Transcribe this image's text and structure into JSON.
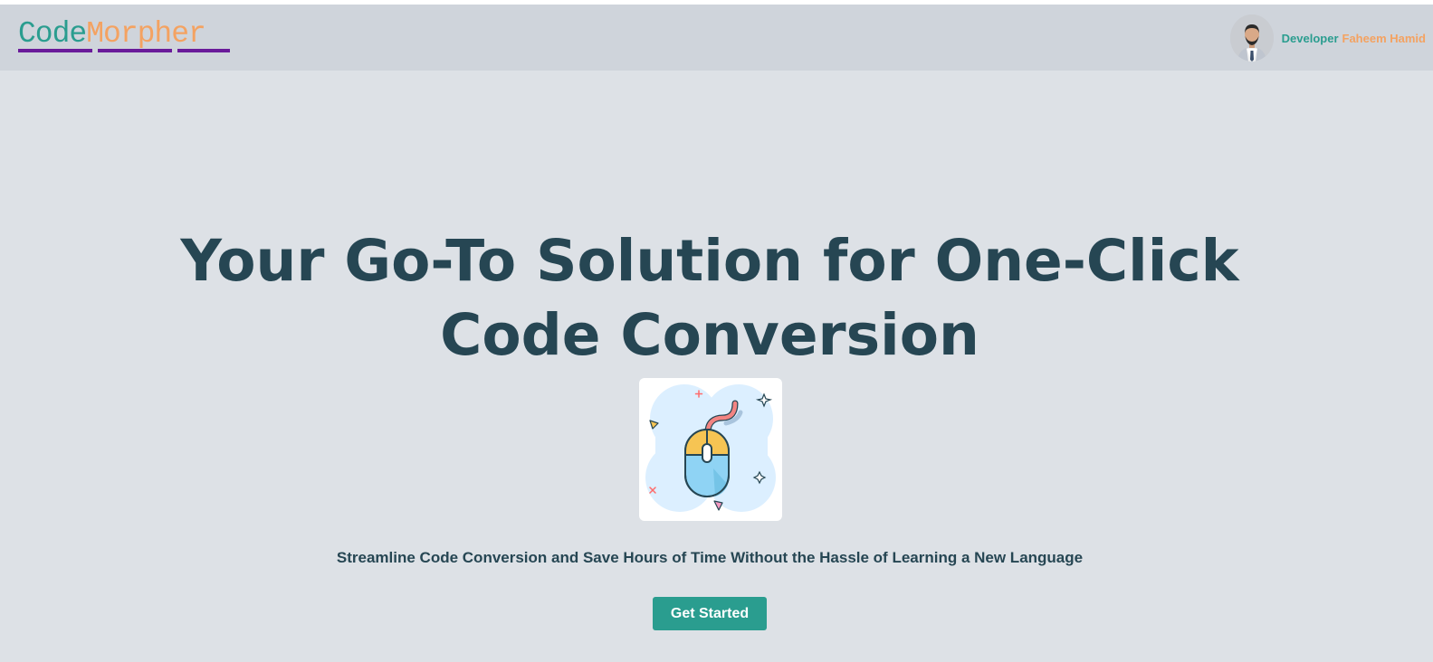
{
  "header": {
    "logo": {
      "part1": "Code",
      "part2": "Morpher"
    },
    "developer": {
      "label": "Developer",
      "name": "Faheem Hamid"
    }
  },
  "hero": {
    "title": "Your Go-To Solution for One-Click Code Conversion",
    "tagline": "Streamline Code Conversion and Save Hours of Time Without the Hassle of Learning a New Language",
    "cta_label": "Get Started",
    "image_icon": "mouse-icon"
  },
  "colors": {
    "teal": "#2a9d8f",
    "orange": "#f4a261",
    "dark": "#264653",
    "navbar": "#cfd4db",
    "background": "#dde1e6"
  }
}
